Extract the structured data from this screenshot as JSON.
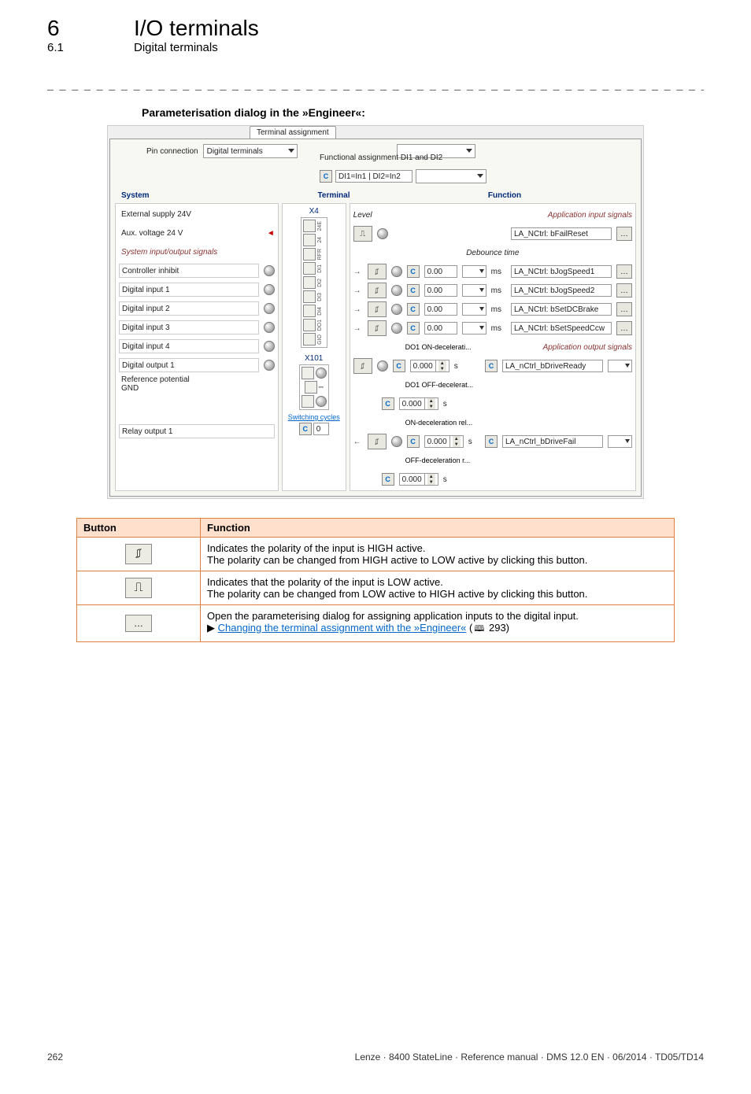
{
  "header": {
    "chapter_num": "6",
    "chapter_title": "I/O terminals",
    "section_num": "6.1",
    "section_title": "Digital terminals"
  },
  "dashes": "_ _ _ _ _ _ _ _ _ _ _ _ _ _ _ _ _ _ _ _ _ _ _ _ _ _ _ _ _ _ _ _ _ _ _ _ _ _ _ _ _ _ _ _ _ _ _ _ _ _ _ _ _ _ _ _ _ _ _ _ _ _ _ _",
  "section_heading": "Parameterisation dialog in the »Engineer«:",
  "screenshot": {
    "tab": "Terminal assignment",
    "pin_label": "Pin connection",
    "pin_value": "Digital terminals",
    "func_assign_label": "Functional assignment DI1 and DI2",
    "func_assign_value": "DI1=In1 | DI2=In2",
    "headers": {
      "system": "System",
      "terminal": "Terminal",
      "function": "Function"
    },
    "system": {
      "ext_supply": "External supply 24V",
      "aux_voltage": "Aux. voltage 24 V",
      "sio_signals": "System input/output signals",
      "ctrl_inhibit": "Controller inhibit",
      "di1": "Digital input 1",
      "di2": "Digital input 2",
      "di3": "Digital input 3",
      "di4": "Digital input 4",
      "do1": "Digital output 1",
      "ref_gnd": "Reference potential\nGND",
      "relay": "Relay output 1"
    },
    "terminal": {
      "x4": "X4",
      "pins": [
        "24E",
        "24",
        "RFR",
        "DI1",
        "DI2",
        "DI3",
        "DI4",
        "DO1",
        "GIO"
      ],
      "x101": "X101",
      "switching": "Switching cycles",
      "switching_val": "0"
    },
    "function": {
      "level_label": "Level",
      "app_in_title": "Application input signals",
      "sig_failreset": "LA_NCtrl: bFailReset",
      "debounce_label": "Debounce time",
      "rows": [
        {
          "val": "0.00",
          "unit": "ms",
          "sig": "LA_NCtrl: bJogSpeed1"
        },
        {
          "val": "0.00",
          "unit": "ms",
          "sig": "LA_NCtrl: bJogSpeed2"
        },
        {
          "val": "0.00",
          "unit": "ms",
          "sig": "LA_NCtrl: bSetDCBrake"
        },
        {
          "val": "0.00",
          "unit": "ms",
          "sig": "LA_NCtrl: bSetSpeedCcw"
        }
      ],
      "do1_on_label": "DO1 ON-decelerati...",
      "do1_on_val": "0.000",
      "do1_off_label": "DO1 OFF-decelerat...",
      "do1_off_val": "0.000",
      "on_decel_label": "ON-deceleration rel...",
      "on_decel_val": "0.000",
      "off_decel_label": "OFF-deceleration r...",
      "off_decel_val": "0.000",
      "s_unit": "s",
      "app_out_title": "Application output signals",
      "out_sig1": "LA_nCtrl_bDriveReady",
      "out_sig2": "LA_nCtrl_bDriveFail"
    }
  },
  "table": {
    "h_button": "Button",
    "h_function": "Function",
    "r1a": "Indicates the polarity of the input is HIGH active.",
    "r1b": "The polarity can be changed from HIGH active to LOW active by clicking this button.",
    "r2a": "Indicates that the polarity of the input is LOW active.",
    "r2b": "The polarity can be changed from LOW active to HIGH active by clicking this button.",
    "r3a": "Open the parameterising dialog for assigning application inputs to the digital input.",
    "r3_link_prefix": "▶ ",
    "r3_link_text": "Changing the terminal assignment with the »Engineer«",
    "r3_link_page": " 293)"
  },
  "footer": {
    "page": "262",
    "right": "Lenze · 8400 StateLine · Reference manual · DMS 12.0 EN · 06/2014 · TD05/TD14"
  }
}
